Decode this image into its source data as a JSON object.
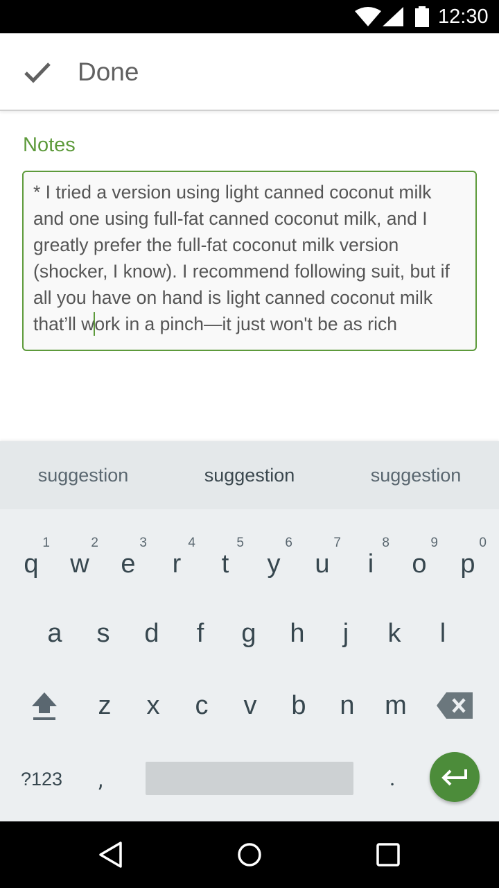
{
  "status_bar": {
    "time": "12:30",
    "icons": [
      "wifi-icon",
      "signal-icon",
      "battery-icon"
    ]
  },
  "app_bar": {
    "done_label": "Done",
    "icon": "check-icon"
  },
  "notes": {
    "label": "Notes",
    "text_before_cursor": "* I tried a version using light canned coconut milk and one using full-fat canned coconut milk, and I greatly prefer the full-fat coconut milk version (shocker, I know). I recommend following suit, but if all you have on hand is light canned coconut milk that’ll w",
    "text_after_cursor": "ork in a pinch—it just won't be as rich",
    "accent_color": "#5d9a3b"
  },
  "keyboard": {
    "suggestions": [
      "suggestion",
      "suggestion",
      "suggestion"
    ],
    "row1": [
      {
        "key": "q",
        "hint": "1"
      },
      {
        "key": "w",
        "hint": "2"
      },
      {
        "key": "e",
        "hint": "3"
      },
      {
        "key": "r",
        "hint": "4"
      },
      {
        "key": "t",
        "hint": "5"
      },
      {
        "key": "y",
        "hint": "6"
      },
      {
        "key": "u",
        "hint": "7"
      },
      {
        "key": "i",
        "hint": "8"
      },
      {
        "key": "o",
        "hint": "9"
      },
      {
        "key": "p",
        "hint": "0"
      }
    ],
    "row2": [
      "a",
      "s",
      "d",
      "f",
      "g",
      "h",
      "j",
      "k",
      "l"
    ],
    "row3": [
      "z",
      "x",
      "c",
      "v",
      "b",
      "n",
      "m"
    ],
    "symbols_label": "?123",
    "comma": ",",
    "period": ".",
    "enter_color": "#4c8c3a"
  },
  "nav_bar": {
    "icons": [
      "back-icon",
      "home-icon",
      "recents-icon"
    ]
  }
}
